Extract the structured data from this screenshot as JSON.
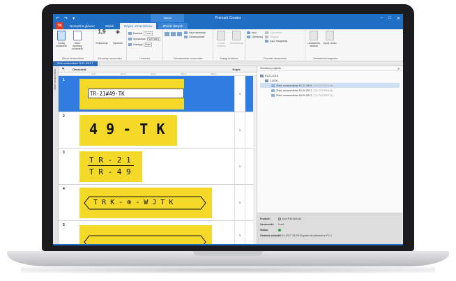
{
  "window": {
    "title": "Promark Creator",
    "context_title": "Tabela",
    "quick_access": [
      "↶",
      "↷",
      "▾"
    ],
    "controls": [
      "–",
      "□",
      "✕"
    ]
  },
  "tabs": {
    "logo": "TK",
    "items": [
      "Narzędzia główne",
      "Widok",
      "Edytor oznaczników",
      "Zbiórki danych"
    ]
  },
  "ribbon": {
    "groups": {
      "g1": {
        "label": "Zbiory oznaczników",
        "b1": "Dodaj oznacznik",
        "b2": "Usuń wybrany oznacznik"
      },
      "g2": {
        "label": "Elementy oznacznika",
        "b1": "Sekwencje",
        "b2": "Symbole",
        "b1_icon": "1,9",
        "b2_icon": "◈"
      },
      "g3": {
        "label": "Czcionka",
        "l1": "Rozmiar",
        "l1v": "3 mm",
        "l2": "Sprasować",
        "l2v": "Normalny",
        "l3": "Odstępy",
        "l3v": "Małe"
      },
      "g4": {
        "label": "Formatowanie oznacznika",
        "l1": "Usuń elementy",
        "l2": "Obramowanie"
      },
      "g5": {
        "label": "Zasięg szablonu",
        "b1": "Ustaw szablon",
        "b2": "Aktualizacja"
      },
      "g6": {
        "label": "Rozmiar oznacznika",
        "l1": "Auto",
        "l2": "Określony",
        "l3": "Szerokość",
        "l4": "Długość",
        "l5": "Łącz marginesy",
        "l6": "Od krawędzi"
      },
      "g7": {
        "label": "Ustawienia marginesu",
        "b1": "Ustawienia obiektu",
        "b2": "Opcje druku"
      }
    }
  },
  "doc_tab": "Zbiór oznaczników 16.21.2019 T",
  "sidebar_label": "Zbiór oznaczników",
  "grid": {
    "filter_icon": "▼",
    "col_label": "Oznacznik",
    "col_copies": "Kopie",
    "ruler": [
      "5mm",
      "10mm",
      "15mm",
      "20mm",
      "25mm"
    ],
    "rows": [
      {
        "num": "1",
        "text": "TR-21#49-TK",
        "copies": "1"
      },
      {
        "num": "2",
        "text": "4 9 - T K",
        "copies": "1"
      },
      {
        "num": "3",
        "text_top": "T R - 2 1",
        "text_bottom": "T R - 4 9",
        "copies": "1"
      },
      {
        "num": "4",
        "text": "T R K - ⊕ - W J T K",
        "copies": "1"
      },
      {
        "num": "5",
        "copies": "1"
      }
    ]
  },
  "structure": {
    "title": "Struktura projektu",
    "close": "✕",
    "root": "RL21-2018",
    "child": "1.0000",
    "items": [
      {
        "name": "Zbiór oznaczników 16.21.2019",
        "tag": "(TK-P4Z300444)"
      },
      {
        "name": "Zbiór oznaczników 18.01.2017",
        "tag": "(TK-P4Z300444)"
      },
      {
        "name": "Zbiór oznaczników 18.01.2017",
        "tag": "(TK-P4Z300474)"
      }
    ]
  },
  "properties": {
    "product_label": "Produkt:",
    "product_value": "Kod P4Z300444",
    "labels_label": "Oznaczniki:",
    "labels_value": "5 szt.",
    "status_label": "Status:",
    "modified_label": "Ostatnia zmiana:",
    "modified_value": "18.01.2017 15:28:24 przez drucktomil w PC-1"
  },
  "colors": {
    "brand": "#1f6fc4",
    "label_yellow": "#f5d928",
    "selection": "#2f7de0"
  }
}
